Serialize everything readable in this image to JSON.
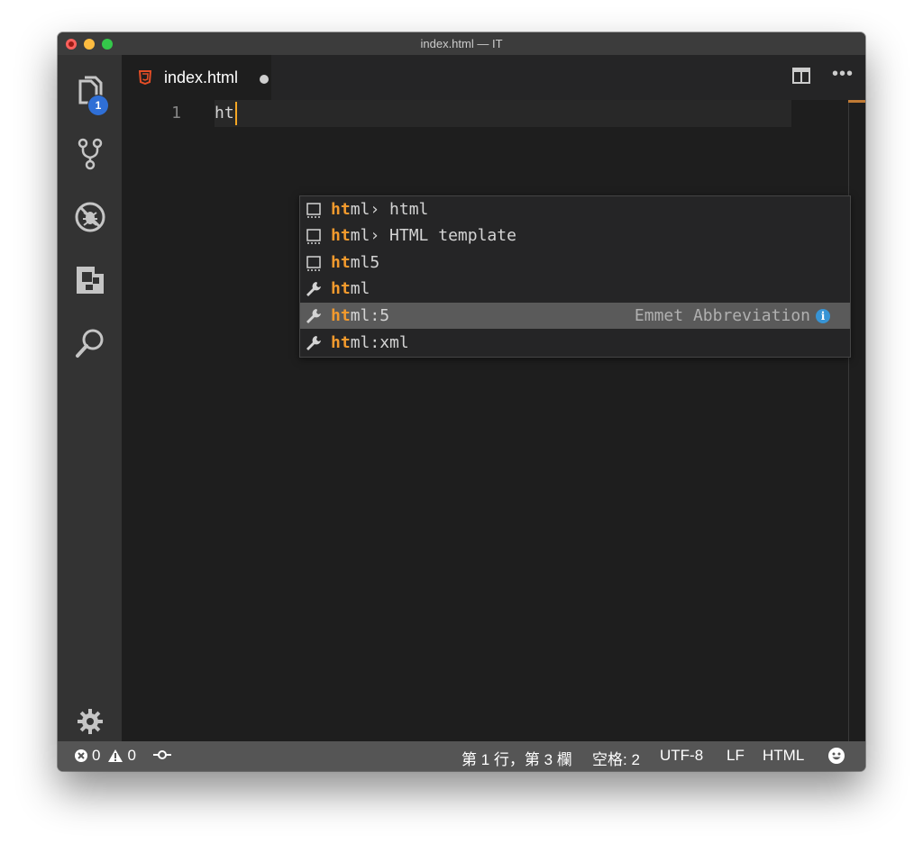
{
  "window": {
    "title": "index.html — IT"
  },
  "activity_bar": {
    "items": [
      {
        "name": "explorer",
        "icon": "files-icon",
        "badge": "1"
      },
      {
        "name": "source-control",
        "icon": "git-branch-icon"
      },
      {
        "name": "debug",
        "icon": "no-bug-icon"
      },
      {
        "name": "extensions",
        "icon": "extensions-icon"
      },
      {
        "name": "search",
        "icon": "search-icon"
      }
    ],
    "settings_icon": "gear-icon"
  },
  "tabs": [
    {
      "label": "index.html",
      "icon": "html5-icon",
      "dirty": true
    }
  ],
  "editor": {
    "lines": [
      {
        "number": "1",
        "text": "ht"
      }
    ]
  },
  "suggest": {
    "items": [
      {
        "match": "ht",
        "rest": "ml",
        "suffix": "› html",
        "icon": "snippet-icon"
      },
      {
        "match": "ht",
        "rest": "ml",
        "suffix": "› HTML template",
        "icon": "snippet-icon"
      },
      {
        "match": "ht",
        "rest": "ml5",
        "suffix": "",
        "icon": "snippet-icon"
      },
      {
        "match": "ht",
        "rest": "ml",
        "suffix": "",
        "icon": "wrench-icon"
      },
      {
        "match": "ht",
        "rest": "ml:5",
        "suffix": "",
        "icon": "wrench-icon",
        "detail": "Emmet Abbreviation",
        "selected": true
      },
      {
        "match": "ht",
        "rest": "ml:xml",
        "suffix": "",
        "icon": "wrench-icon"
      }
    ]
  },
  "status_bar": {
    "errors": "0",
    "warnings": "0",
    "position": "第 1 行，第 3 欄",
    "indent": "空格: 2",
    "encoding": "UTF-8",
    "eol": "LF",
    "language": "HTML"
  },
  "colors": {
    "accent": "#f39a2d",
    "badge": "#2f6fd6",
    "info": "#3794d5",
    "statusbar": "#555555"
  }
}
